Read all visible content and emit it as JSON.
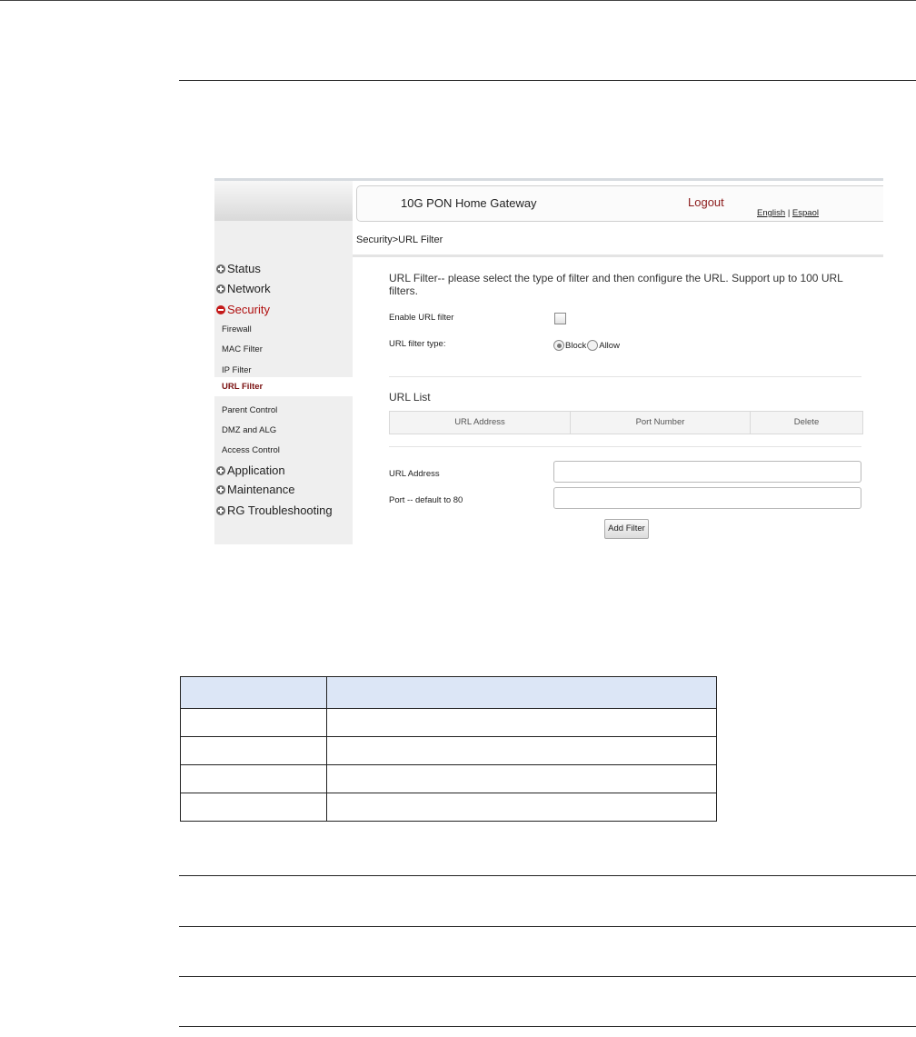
{
  "gateway": {
    "title": "10G PON Home Gateway",
    "logout": "Logout",
    "lang_english": "English",
    "lang_separator": "|",
    "lang_espanol": "Espaol"
  },
  "sidebar": {
    "top": [
      {
        "label": "Status"
      },
      {
        "label": "Network"
      },
      {
        "label": "Security"
      },
      {
        "label": "Application"
      },
      {
        "label": "Maintenance"
      },
      {
        "label": "RG Troubleshooting"
      }
    ],
    "security_sub": [
      {
        "label": "Firewall"
      },
      {
        "label": "MAC Filter"
      },
      {
        "label": "IP Filter"
      },
      {
        "label": "URL Filter"
      },
      {
        "label": "Parent Control"
      },
      {
        "label": "DMZ and ALG"
      },
      {
        "label": "Access Control"
      }
    ]
  },
  "breadcrumb": "Security>URL Filter",
  "content": {
    "intro": "URL Filter-- please select the type of filter and then configure the URL. Support up to 100 URL filters.",
    "enable_label": "Enable URL filter",
    "enable_checked": false,
    "type_label": "URL filter type:",
    "type_options": [
      "Block",
      "Allow"
    ],
    "type_selected": "Block",
    "url_list_title": "URL List",
    "list_columns": [
      "URL Address",
      "Port Number",
      "Delete"
    ],
    "url_address_label": "URL Address",
    "url_address_value": "",
    "port_label": "Port -- default to 80",
    "port_value": "",
    "add_button": "Add Filter"
  },
  "lower_table": {
    "rows": 5,
    "columns": 2
  }
}
